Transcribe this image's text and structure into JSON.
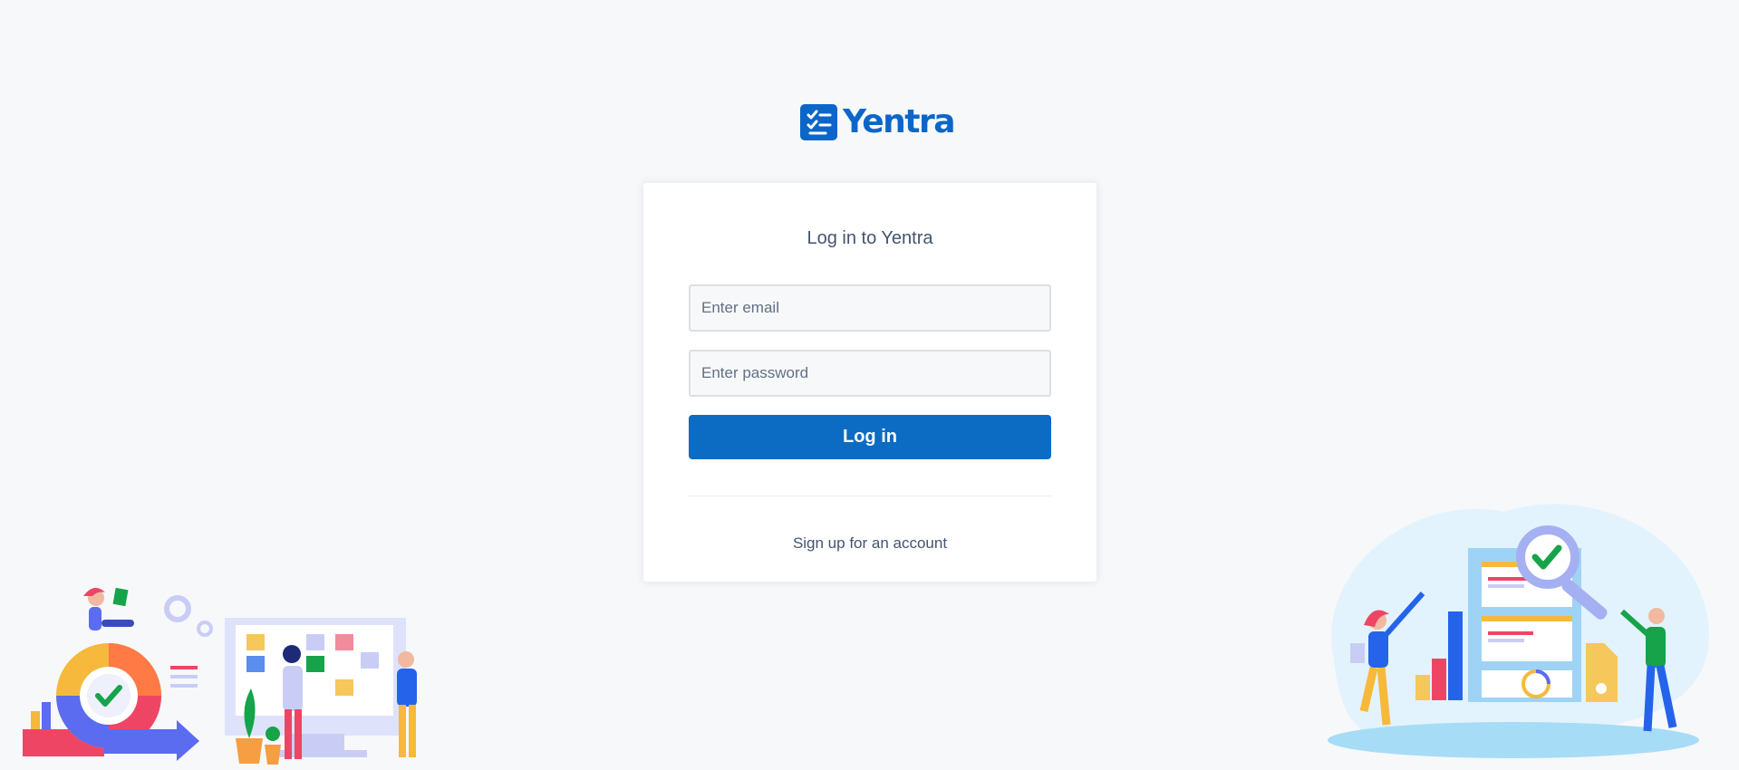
{
  "brand": {
    "name": "Yentra",
    "logo_icon": "checklist-icon",
    "color": "#0c66c8"
  },
  "login": {
    "title": "Log in to Yentra",
    "email_placeholder": "Enter email",
    "email_value": "",
    "password_placeholder": "Enter password",
    "password_value": "",
    "submit_label": "Log in",
    "button_color": "#0c6bc2",
    "signup_link": "Sign up for an account"
  },
  "illustrations": {
    "left": "team-planning-illustration",
    "right": "analytics-review-illustration"
  }
}
